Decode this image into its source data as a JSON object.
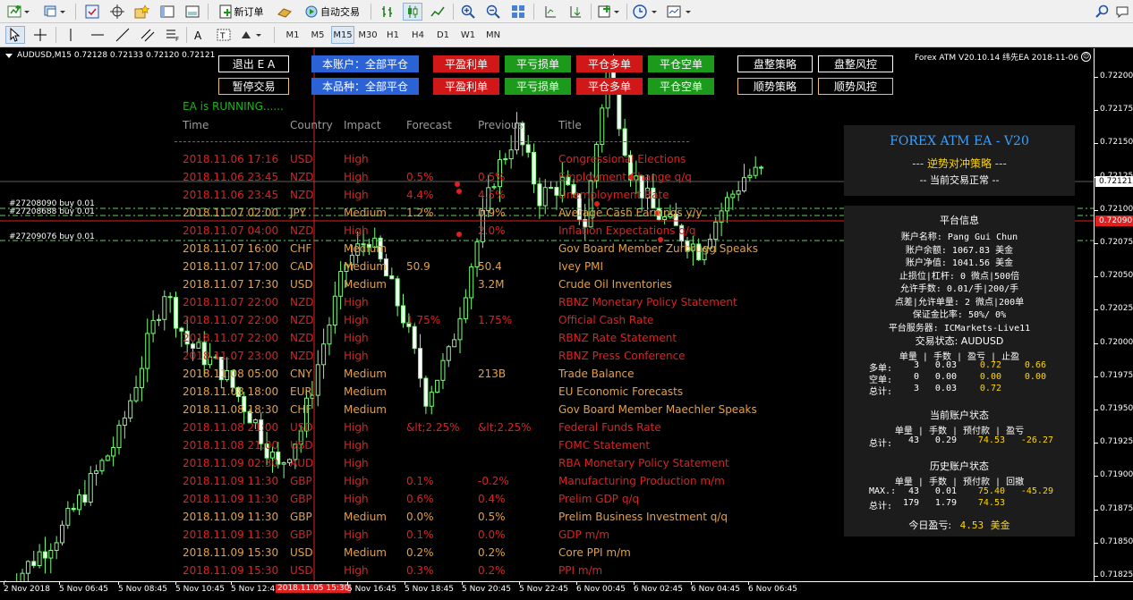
{
  "toolbar": {
    "new_order_label": "新订单",
    "auto_trade_label": "自动交易",
    "timeframes": [
      "M1",
      "M5",
      "M15",
      "M30",
      "H1",
      "H4",
      "D1",
      "W1",
      "MN"
    ],
    "active_timeframe": "M15"
  },
  "chart": {
    "symbol_info": "AUDUSD,M15  0.72128 0.72133 0.72120 0.72121",
    "ea_title": "Forex ATM  V20.10.14  纬先EA 2018-11-06",
    "ea_status": "EA is RUNNING......",
    "orders": [
      "#27208090 buy 0.01",
      "#27208688 buy 0.01",
      "#27209076 buy 0.01"
    ],
    "current_price": "0.72121",
    "bid_line_price": "0.72090"
  },
  "buttons": {
    "exit_ea": "退出 E A",
    "pause_trade": "暂停交易",
    "acct_close_all": "本账户：全部平仓",
    "sym_close_all": "本品种：全部平仓",
    "close_profit": "平盈利单",
    "close_loss": "平亏损单",
    "close_buy": "平仓多单",
    "close_sell": "平仓空单",
    "range_strategy": "盘整策略",
    "range_risk": "盘整风控",
    "trend_strategy": "顺势策略",
    "trend_risk": "顺势风控"
  },
  "news": {
    "headers": [
      "Time",
      "Country",
      "Impact",
      "Forecast",
      "Previous",
      "Title"
    ],
    "rows": [
      {
        "time": "2018.11.06 17:16",
        "country": "USD",
        "impact": "High",
        "forecast": "",
        "previous": "",
        "title": "Congressional Elections",
        "color": "#e02020"
      },
      {
        "time": "2018.11.06 23:45",
        "country": "NZD",
        "impact": "High",
        "forecast": "0.5%",
        "previous": "0.5%",
        "title": "Employment Change q/q",
        "color": "#e02020"
      },
      {
        "time": "2018.11.06 23:45",
        "country": "NZD",
        "impact": "High",
        "forecast": "4.4%",
        "previous": "4.5%",
        "title": "Unemployment Rate",
        "color": "#e02020"
      },
      {
        "time": "2018.11.07 02:00",
        "country": "JPY",
        "impact": "Medium",
        "forecast": "1.2%",
        "previous": "0.9%",
        "title": "Average Cash Earnings y/y",
        "color": "#e8a040"
      },
      {
        "time": "2018.11.07 04:00",
        "country": "NZD",
        "impact": "High",
        "forecast": "",
        "previous": "2.0%",
        "title": "Inflation Expectations q/q",
        "color": "#e02020"
      },
      {
        "time": "2018.11.07 16:00",
        "country": "CHF",
        "impact": "Medium",
        "forecast": "",
        "previous": "",
        "title": "Gov Board Member Zurbrugg Speaks",
        "color": "#e8a040"
      },
      {
        "time": "2018.11.07 17:00",
        "country": "CAD",
        "impact": "Medium",
        "forecast": "50.9",
        "previous": "50.4",
        "title": "Ivey PMI",
        "color": "#e8a040"
      },
      {
        "time": "2018.11.07 17:30",
        "country": "USD",
        "impact": "Medium",
        "forecast": "",
        "previous": "3.2M",
        "title": "Crude Oil Inventories",
        "color": "#e8a040"
      },
      {
        "time": "2018.11.07 22:00",
        "country": "NZD",
        "impact": "High",
        "forecast": "",
        "previous": "",
        "title": "RBNZ Monetary Policy Statement",
        "color": "#e02020"
      },
      {
        "time": "2018.11.07 22:00",
        "country": "NZD",
        "impact": "High",
        "forecast": "1.75%",
        "previous": "1.75%",
        "title": "Official Cash Rate",
        "color": "#e02020"
      },
      {
        "time": "2018.11.07 22:00",
        "country": "NZD",
        "impact": "High",
        "forecast": "",
        "previous": "",
        "title": "RBNZ Rate Statement",
        "color": "#e02020"
      },
      {
        "time": "2018.11.07 23:00",
        "country": "NZD",
        "impact": "High",
        "forecast": "",
        "previous": "",
        "title": "RBNZ Press Conference",
        "color": "#e02020"
      },
      {
        "time": "2018.11.08 05:00",
        "country": "CNY",
        "impact": "Medium",
        "forecast": "",
        "previous": "213B",
        "title": "Trade Balance",
        "color": "#e8a040"
      },
      {
        "time": "2018.11.08 18:00",
        "country": "EUR",
        "impact": "Medium",
        "forecast": "",
        "previous": "",
        "title": "EU Economic Forecasts",
        "color": "#e8a040"
      },
      {
        "time": "2018.11.08 18:30",
        "country": "CHF",
        "impact": "Medium",
        "forecast": "",
        "previous": "",
        "title": "Gov Board Member Maechler Speaks",
        "color": "#e8a040"
      },
      {
        "time": "2018.11.08 21:00",
        "country": "USD",
        "impact": "High",
        "forecast": "&lt;2.25%",
        "previous": "&lt;2.25%",
        "title": "Federal Funds Rate",
        "color": "#e02020"
      },
      {
        "time": "2018.11.08 21:00",
        "country": "USD",
        "impact": "High",
        "forecast": "",
        "previous": "",
        "title": "FOMC Statement",
        "color": "#e02020"
      },
      {
        "time": "2018.11.09 02:30",
        "country": "AUD",
        "impact": "High",
        "forecast": "",
        "previous": "",
        "title": "RBA Monetary Policy Statement",
        "color": "#e02020"
      },
      {
        "time": "2018.11.09 11:30",
        "country": "GBP",
        "impact": "High",
        "forecast": "0.1%",
        "previous": "-0.2%",
        "title": "Manufacturing Production m/m",
        "color": "#e02020"
      },
      {
        "time": "2018.11.09 11:30",
        "country": "GBP",
        "impact": "High",
        "forecast": "0.6%",
        "previous": "0.4%",
        "title": "Prelim GDP q/q",
        "color": "#e02020"
      },
      {
        "time": "2018.11.09 11:30",
        "country": "GBP",
        "impact": "Medium",
        "forecast": "0.0%",
        "previous": "0.5%",
        "title": "Prelim Business Investment q/q",
        "color": "#e8a040"
      },
      {
        "time": "2018.11.09 11:30",
        "country": "GBP",
        "impact": "High",
        "forecast": "0.1%",
        "previous": "0.0%",
        "title": "GDP m/m",
        "color": "#e02020"
      },
      {
        "time": "2018.11.09 15:30",
        "country": "USD",
        "impact": "Medium",
        "forecast": "0.2%",
        "previous": "0.2%",
        "title": "Core PPI m/m",
        "color": "#e8a040"
      },
      {
        "time": "2018.11.09 15:30",
        "country": "USD",
        "impact": "High",
        "forecast": "0.3%",
        "previous": "0.2%",
        "title": "PPI m/m",
        "color": "#e02020"
      }
    ]
  },
  "panel": {
    "brand": "FOREX ATM EA - V20",
    "strategy": "--- 逆势对冲策略 ---",
    "trade_status": "-- 当前交易正常 --",
    "platform_title": "平台信息",
    "platform_lines": [
      "账户名称: Pang Gui Chun",
      "账户余额: 1067.83 美金",
      "账户净值: 1041.56 美金",
      "止损位|杠杆: 0 微点|500倍",
      "允许手数: 0.01/手|200/手",
      "点差|允许单量: 2 微点|200单",
      "保证金比率: 50%/ 0%",
      "平台服务器: ICMarkets-Live11"
    ],
    "trade_title": "交易状态: AUDUSD",
    "trade_header": "单量 | 手数 | 盈亏 | 止盈",
    "trade_rows": [
      {
        "label": "多单:",
        "count": "3",
        "lots": "0.03",
        "pnl": "0.72",
        "tp": "0.66"
      },
      {
        "label": "空单:",
        "count": "0",
        "lots": "0.00",
        "pnl": "0.00",
        "tp": "0.00"
      },
      {
        "label": "总计:",
        "count": "3",
        "lots": "0.03",
        "pnl": "0.72",
        "tp": ""
      }
    ],
    "current_title": "当前账户状态",
    "current_header": "单量 | 手数 | 预付款 | 盈亏",
    "current_row": {
      "label": "总计:",
      "count": "43",
      "lots": "0.29",
      "margin": "74.53",
      "pnl": "-26.27"
    },
    "history_title": "历史账户状态",
    "history_header": "单量 | 手数 | 预付款 | 回撤",
    "history_rows": [
      {
        "label": "MAX.:",
        "count": "43",
        "lots": "0.01",
        "margin": "75.40",
        "dd": "-45.29"
      },
      {
        "label": "总计:",
        "count": "179",
        "lots": "1.79",
        "margin": "74.53",
        "dd": ""
      }
    ],
    "today_label": "今日盈亏:",
    "today_value": "4.53",
    "today_unit": "美金"
  },
  "price_axis": [
    "0.72200",
    "0.72175",
    "0.72150",
    "0.72125",
    "0.72100",
    "0.72075",
    "0.72050",
    "0.72025",
    "0.72000",
    "0.71975",
    "0.71950",
    "0.71925",
    "0.71900",
    "0.71875",
    "0.71850",
    "0.71825"
  ],
  "time_axis": [
    "2 Nov 2018",
    "5 Nov 06:45",
    "5 Nov 08:45",
    "5 Nov 10:45",
    "5 Nov 12:45",
    "2018.11.05 15:30",
    "5 Nov 16:45",
    "5 Nov 18:45",
    "5 Nov 20:45",
    "5 Nov 22:45",
    "6 Nov 00:45",
    "6 Nov 02:45",
    "6 Nov 04:45",
    "6 Nov 06:45"
  ],
  "colors": {
    "bull": "#7bff7b",
    "bear": "#7bff7b",
    "text_red": "#e02020",
    "text_orange": "#e8a040",
    "panel_gold": "#ffd700",
    "highlight": "#e02020"
  }
}
